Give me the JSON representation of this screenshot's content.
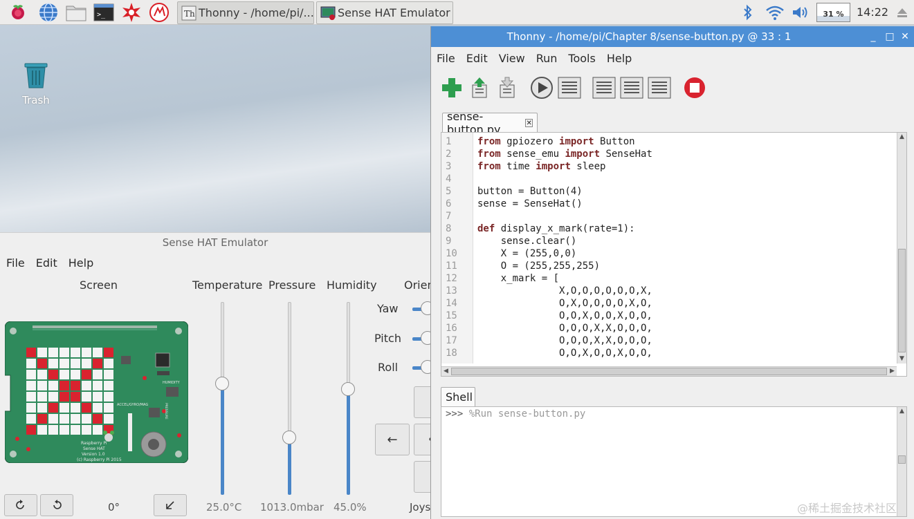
{
  "taskbar": {
    "tasks": [
      {
        "label": "Thonny  -  /home/pi/..."
      },
      {
        "label": "Sense HAT Emulator"
      }
    ],
    "cpu": {
      "text": "31 %",
      "percent": 31
    },
    "clock": "14:22"
  },
  "desktop": {
    "trash_label": "Trash"
  },
  "sense_hat": {
    "title": "Sense HAT Emulator",
    "menu": [
      "File",
      "Edit",
      "Help"
    ],
    "columns": {
      "screen": "Screen",
      "temperature": "Temperature",
      "pressure": "Pressure",
      "humidity": "Humidity",
      "orientation": "Orien"
    },
    "orientation_labels": [
      "Yaw",
      "Pitch",
      "Roll"
    ],
    "values": {
      "temperature": "25.0°C",
      "pressure": "1013.0mbar",
      "humidity": "45.0%",
      "rotation": "0°",
      "joystick": "Joys"
    },
    "slider_levels": {
      "temperature": 0.58,
      "pressure": 0.3,
      "humidity": 0.55
    },
    "board_text": {
      "humidity": "HUMIDITY",
      "pressure": "PRESSURE",
      "accel": "ACCEL/GYRO/MAG",
      "line1": "Raspberry Pi",
      "line2": "Sense HAT",
      "line3": "Version 1.0",
      "line4": "(c) Raspberry Pi 2015"
    },
    "led_matrix": [
      "RWWWWWWR",
      "WRWWWWRW",
      "WWRWWRWW",
      "WWWRRWWW",
      "WWWRRWWW",
      "WWRWWRWW",
      "WRWWWWRW",
      "RWWWWWWR"
    ],
    "joystick_buttons": [
      "←",
      "•"
    ]
  },
  "thonny": {
    "title": "Thonny  -  /home/pi/Chapter 8/sense-button.py  @  33 : 1",
    "menu": [
      "File",
      "Edit",
      "View",
      "Run",
      "Tools",
      "Help"
    ],
    "editor_tab": "sense-button.py",
    "close_glyph": "✕",
    "line_numbers": [
      "1",
      "2",
      "3",
      "4",
      "5",
      "6",
      "7",
      "8",
      "9",
      "10",
      "11",
      "12",
      "13",
      "14",
      "15",
      "16",
      "17",
      "18"
    ],
    "code": [
      {
        "k1": "from",
        "t1": " gpiozero ",
        "k2": "import",
        "t2": " Button"
      },
      {
        "k1": "from",
        "t1": " sense_emu ",
        "k2": "import",
        "t2": " SenseHat"
      },
      {
        "k1": "from",
        "t1": " time ",
        "k2": "import",
        "t2": " sleep"
      },
      {
        "k1": "",
        "t1": "",
        "k2": "",
        "t2": ""
      },
      {
        "k1": "",
        "t1": "button = Button(4)",
        "k2": "",
        "t2": ""
      },
      {
        "k1": "",
        "t1": "sense = SenseHat()",
        "k2": "",
        "t2": ""
      },
      {
        "k1": "",
        "t1": "",
        "k2": "",
        "t2": ""
      },
      {
        "k1": "def",
        "t1": " display_x_mark(rate=1):",
        "k2": "",
        "t2": ""
      },
      {
        "k1": "",
        "t1": "    sense.clear()",
        "k2": "",
        "t2": ""
      },
      {
        "k1": "",
        "t1": "    X = (255,0,0)",
        "k2": "",
        "t2": ""
      },
      {
        "k1": "",
        "t1": "    O = (255,255,255)",
        "k2": "",
        "t2": ""
      },
      {
        "k1": "",
        "t1": "    x_mark = [",
        "k2": "",
        "t2": ""
      },
      {
        "k1": "",
        "t1": "              X,O,O,O,O,O,O,X,",
        "k2": "",
        "t2": ""
      },
      {
        "k1": "",
        "t1": "              O,X,O,O,O,O,X,O,",
        "k2": "",
        "t2": ""
      },
      {
        "k1": "",
        "t1": "              O,O,X,O,O,X,O,O,",
        "k2": "",
        "t2": ""
      },
      {
        "k1": "",
        "t1": "              O,O,O,X,X,O,O,O,",
        "k2": "",
        "t2": ""
      },
      {
        "k1": "",
        "t1": "              O,O,O,X,X,O,O,O,",
        "k2": "",
        "t2": ""
      },
      {
        "k1": "",
        "t1": "              O,O,X,O,O,X,O,O,",
        "k2": "",
        "t2": ""
      }
    ],
    "shell_tab": "Shell",
    "shell": {
      "prompt": ">>>",
      "command": " %Run sense-button.py"
    }
  },
  "watermark": "@稀土掘金技术社区",
  "colors": {
    "led_red": "#d9232f",
    "led_white": "#f4f4f4",
    "board_green": "#2f8a5c",
    "accent_blue": "#4d8fd5"
  }
}
